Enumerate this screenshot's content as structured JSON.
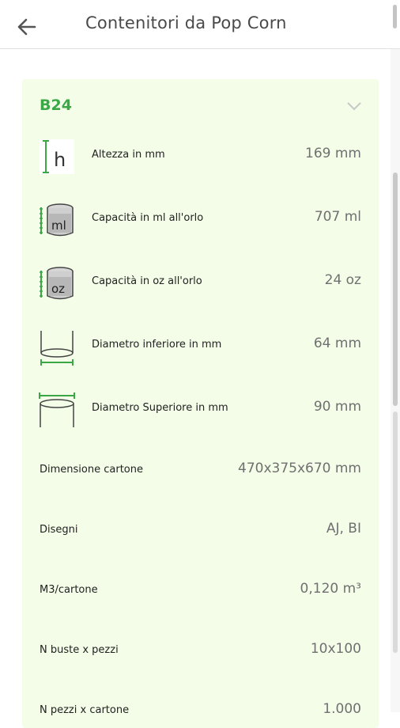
{
  "appbar": {
    "title": "Contenitori da Pop Corn",
    "back_icon": "arrow-left-icon"
  },
  "colors": {
    "accent": "#3aa845",
    "card_bg": "#f4fde8",
    "value_text": "#707070"
  },
  "card": {
    "code": "B24",
    "chevron_icon": "chevron-down-icon",
    "specs": [
      {
        "icon": "height-icon",
        "label": "Altezza in mm",
        "value": "169 mm"
      },
      {
        "icon": "capacity-ml-icon",
        "icon_text": "ml",
        "label": "Capacità in ml all'orlo",
        "value": "707 ml"
      },
      {
        "icon": "capacity-oz-icon",
        "icon_text": "oz",
        "label": "Capacità in oz all'orlo",
        "value": "24 oz"
      },
      {
        "icon": "bottom-diameter-icon",
        "label": "Diametro inferiore in mm",
        "value": "64 mm"
      },
      {
        "icon": "top-diameter-icon",
        "label": "Diametro Superiore in mm",
        "value": "90 mm"
      }
    ],
    "info": [
      {
        "label": "Dimensione cartone",
        "value": "470x375x670 mm"
      },
      {
        "label": "Disegni",
        "value": "AJ, BI"
      },
      {
        "label": "M3/cartone",
        "value": "0,120 m³"
      },
      {
        "label": "N buste x pezzi",
        "value": "10x100"
      },
      {
        "label": "N pezzi x cartone",
        "value": "1.000"
      }
    ]
  }
}
